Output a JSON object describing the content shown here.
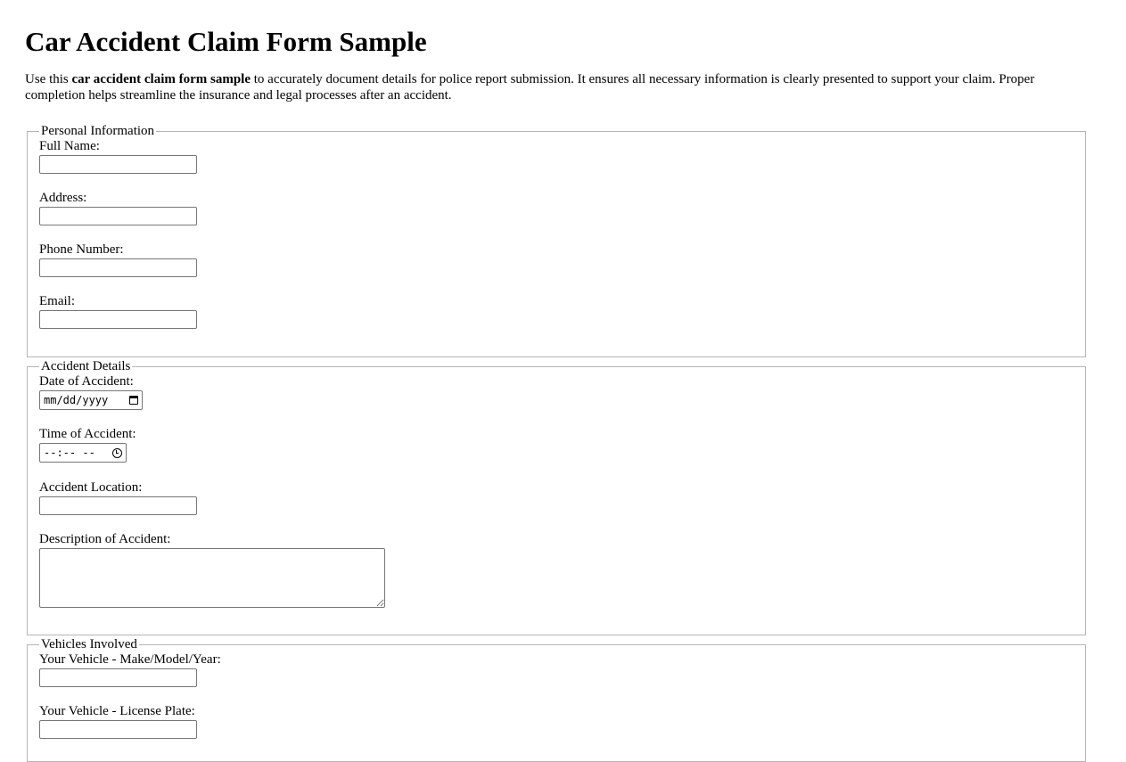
{
  "page": {
    "title": "Car Accident Claim Form Sample",
    "intro_before": "Use this ",
    "intro_bold": "car accident claim form sample",
    "intro_after": " to accurately document details for police report submission. It ensures all necessary information is clearly presented to support your claim. Proper completion helps streamline the insurance and legal processes after an accident."
  },
  "personal": {
    "legend": "Personal Information",
    "full_name_label": "Full Name:",
    "full_name_value": "",
    "address_label": "Address:",
    "address_value": "",
    "phone_label": "Phone Number:",
    "phone_value": "",
    "email_label": "Email:",
    "email_value": ""
  },
  "accident": {
    "legend": "Accident Details",
    "date_label": "Date of Accident:",
    "date_placeholder": "mm/dd/yyyy",
    "time_label": "Time of Accident:",
    "time_placeholder": "--:-- --",
    "location_label": "Accident Location:",
    "location_value": "",
    "description_label": "Description of Accident:",
    "description_value": ""
  },
  "vehicles": {
    "legend": "Vehicles Involved",
    "make_label": "Your Vehicle - Make/Model/Year:",
    "make_value": "",
    "plate_label": "Your Vehicle - License Plate:",
    "plate_value": ""
  }
}
